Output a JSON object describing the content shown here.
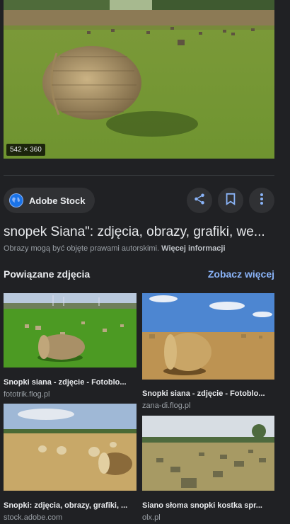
{
  "hero": {
    "dimensions": "542 × 360"
  },
  "source": {
    "name": "Adobe Stock",
    "icon": "globe-icon"
  },
  "actions": {
    "share_icon": "share-icon",
    "save_icon": "bookmark-icon",
    "more_icon": "more-vert-icon"
  },
  "result": {
    "title": "snopek Siana\": zdjęcia, obrazy, grafiki, we...",
    "copyright_text": "Obrazy mogą być objęte prawami autorskimi. ",
    "copyright_link": "Więcej informacji"
  },
  "related": {
    "heading": "Powiązane zdjęcia",
    "see_more": "Zobacz więcej",
    "items": [
      {
        "title": "Snopki siana - zdjęcie - Fotoblo...",
        "source": "fototrik.flog.pl"
      },
      {
        "title": "Snopki siana - zdjęcie - Fotoblo...",
        "source": "zana-di.flog.pl"
      },
      {
        "title": "Snopki: zdjęcia, obrazy, grafiki, ...",
        "source": "stock.adobe.com"
      },
      {
        "title": "Siano słoma snopki kostka spr...",
        "source": "olx.pl"
      }
    ]
  },
  "colors": {
    "background": "#202124",
    "accent": "#8ab4f8",
    "chip": "#303134"
  }
}
